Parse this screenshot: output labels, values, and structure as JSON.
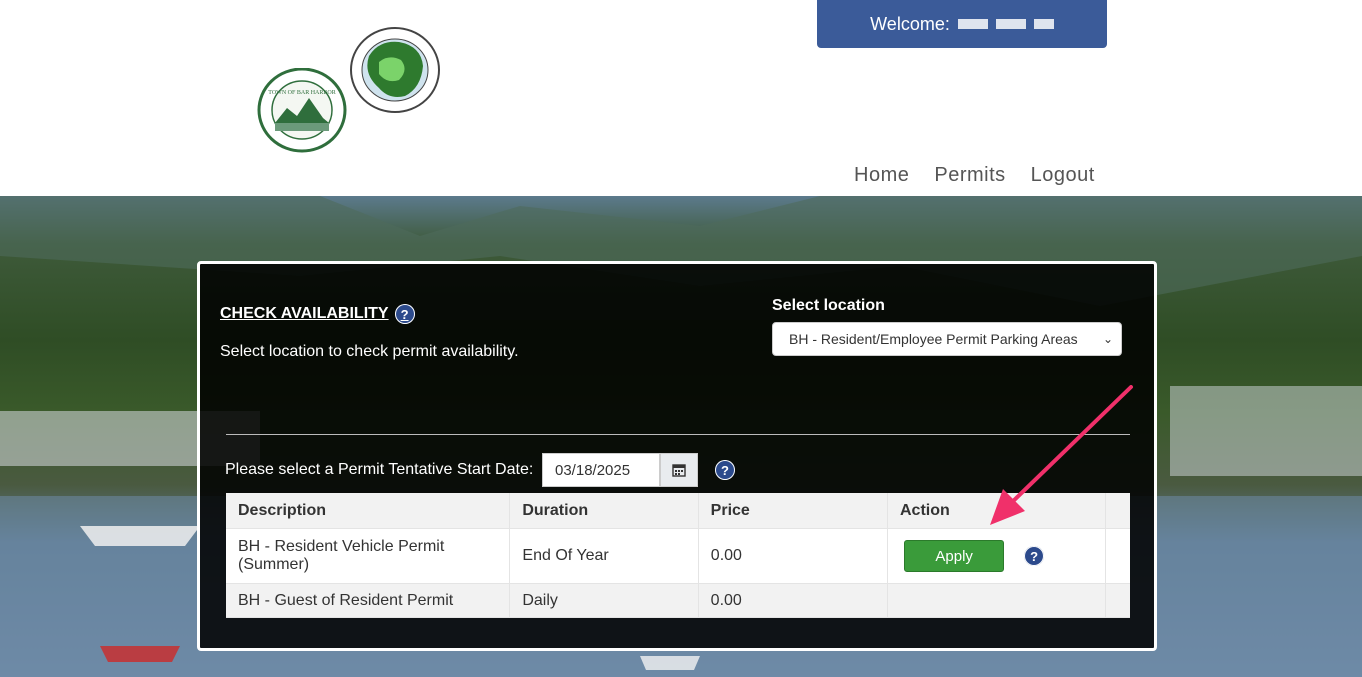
{
  "header": {
    "welcome_label": "Welcome:",
    "logos": {
      "bar_harbor": {
        "top_text": "COUNTY OF HANCOCK · STATE OF MAINE",
        "center_text": "TOWN OF BAR HARBOR",
        "bottom_text": "INCORPORATED 1796"
      },
      "mount_desert": {
        "top_text": "TOWN OF MOUNT DESERT",
        "bottom_text": "INCORPORATED 1789"
      }
    },
    "nav": [
      "Home",
      "Permits",
      "Logout"
    ]
  },
  "panel": {
    "title": "CHECK AVAILABILITY",
    "subtitle": "Select location to check permit availability.",
    "location_label": "Select location",
    "location_selected": "BH - Resident/Employee Permit Parking Areas",
    "date_label": "Please select a Permit Tentative Start Date:",
    "date_value": "03/18/2025"
  },
  "table": {
    "columns": [
      "Description",
      "Duration",
      "Price",
      "Action"
    ],
    "rows": [
      {
        "description": "BH - Resident Vehicle Permit (Summer)",
        "duration": "End Of Year",
        "price": "0.00",
        "action": "Apply"
      },
      {
        "description": "BH - Guest of Resident Permit",
        "duration": "Daily",
        "price": "0.00",
        "action": ""
      }
    ]
  },
  "colors": {
    "welcome_bg": "#3b5b99",
    "apply_button": "#3a9b3a",
    "annotation_arrow": "#f0306a",
    "help_icon": "#2c4a8c"
  },
  "icons": {
    "help": "question-circle-icon",
    "calendar": "calendar-icon",
    "dropdown": "chevron-down-icon"
  }
}
